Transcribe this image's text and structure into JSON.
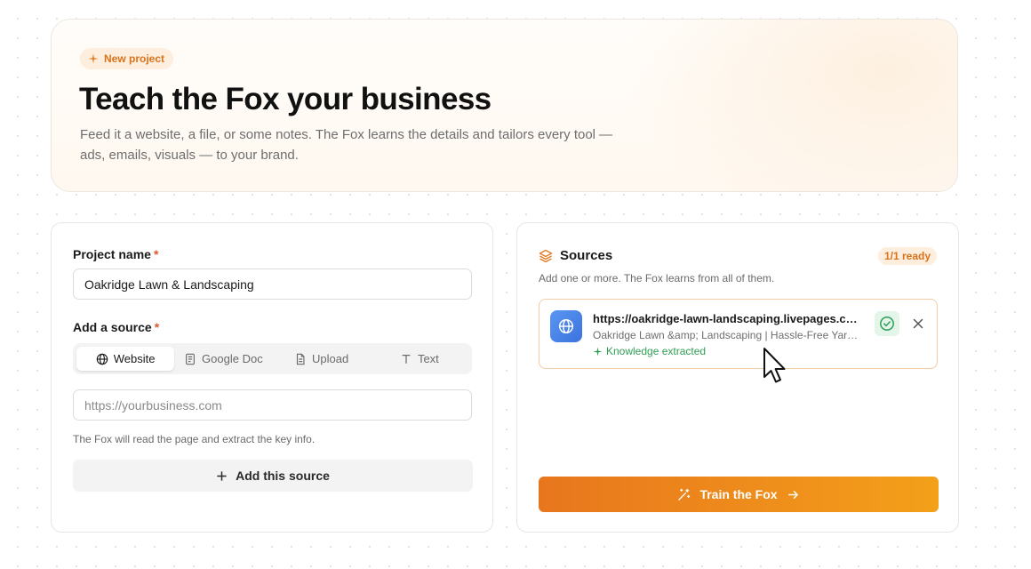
{
  "hero": {
    "badge": "New project",
    "title": "Teach the Fox your business",
    "subtitle": "Feed it a website, a file, or some notes. The Fox learns the details and tailors every tool — ads, emails, visuals — to your brand."
  },
  "form": {
    "project_name_label": "Project name",
    "required_mark": "*",
    "project_name_value": "Oakridge Lawn & Landscaping",
    "add_source_label": "Add a source",
    "tabs": [
      {
        "label": "Website",
        "icon": "globe-icon",
        "active": true
      },
      {
        "label": "Google Doc",
        "icon": "document-icon",
        "active": false
      },
      {
        "label": "Upload",
        "icon": "file-icon",
        "active": false
      },
      {
        "label": "Text",
        "icon": "text-icon",
        "active": false
      }
    ],
    "url_placeholder": "https://yourbusiness.com",
    "url_value": "",
    "hint": "The Fox will read the page and extract the key info.",
    "add_button": "Add this source"
  },
  "sources": {
    "title": "Sources",
    "ready_badge": "1/1 ready",
    "description": "Add one or more. The Fox learns from all of them.",
    "items": [
      {
        "url": "https://oakridge-lawn-landscaping.livepages.com",
        "page_title": "Oakridge Lawn &amp; Landscaping | Hassle-Free Yard Care",
        "status": "Knowledge extracted",
        "icon": "globe-icon"
      }
    ],
    "train_button": "Train the Fox"
  },
  "colors": {
    "accent": "#e8761d",
    "accent_light": "#fdeede",
    "success": "#2f9e55",
    "source_icon_bg": "#3a73de"
  }
}
